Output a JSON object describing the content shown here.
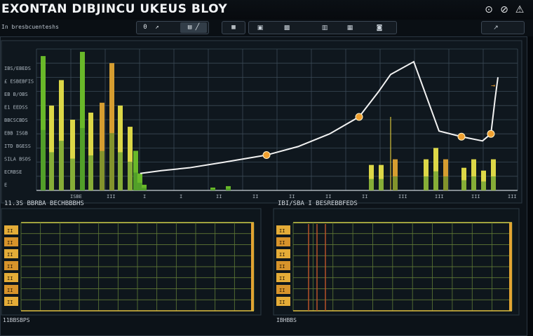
{
  "app": {
    "title": "EXONTAN DIBJINCU UKEUS BLOY"
  },
  "window": {
    "minimize_icon": "minimize-icon",
    "restore_icon": "restore-icon",
    "close_icon": "close-icon"
  },
  "toolbar": {
    "left_label": "In bresbcuenteshs",
    "group1": [
      "0",
      "↗"
    ],
    "group1_active": "▤ ╱",
    "group2_item": "▦",
    "group3": [
      "▣",
      "▩",
      "▥",
      "▦",
      "◙"
    ],
    "group4_item": "↗"
  },
  "colors": {
    "background": "#05080c",
    "panel": "#0c1218",
    "grid": "#3a4a56",
    "line": "#f2f2f2",
    "bar_green": "#6fc12a",
    "bar_yellow": "#e8e14a",
    "bar_orange": "#e2a432",
    "marker": "#f0a030"
  },
  "chart_data": [
    {
      "type": "bar",
      "title": "",
      "xlabel": "",
      "ylabel": "",
      "ylim": [
        0,
        100
      ],
      "y_tick_labels": [
        "IBS/EBEDS",
        "£ ESBEBFIS",
        "EB B/OBS",
        "E1 EEDSS",
        "BBCSCBDS",
        "EBB ISGB",
        "ITD BGESS",
        "SILA BSOS",
        "ECRBSE",
        "E"
      ],
      "x_tick_labels": [
        "ISBE",
        "III",
        "I",
        "I",
        "II",
        "II",
        "II",
        "II",
        "II",
        "III",
        "III",
        "III",
        "III"
      ],
      "series": [
        {
          "values": [
            95,
            60,
            78,
            50,
            98,
            55,
            62,
            90,
            60,
            45,
            28,
            12,
            4,
            2,
            3,
            18,
            18,
            22,
            22,
            30,
            22,
            16,
            22,
            14,
            22
          ]
        }
      ],
      "line": {
        "values": [
          12,
          14,
          16,
          20,
          25,
          31,
          40,
          52,
          70,
          82,
          91,
          42,
          38,
          35,
          40,
          65,
          80
        ]
      },
      "annotations": [
        "→"
      ]
    },
    {
      "type": "heatmap",
      "title": "11.3S BBRBA BECHBBBHS",
      "footer": "11BBSBPS",
      "rows": 8,
      "cols": 12,
      "ylabel_ticks": [
        "II",
        "II",
        "II",
        "II",
        "II",
        "II",
        "II"
      ]
    },
    {
      "type": "heatmap",
      "title": "IBI/SBA I BESREBBFEDS",
      "footer": "IBHBBS",
      "rows": 8,
      "cols": 11,
      "ylabel_ticks": [
        "II",
        "II",
        "II",
        "II",
        "II",
        "II",
        "II"
      ]
    }
  ]
}
